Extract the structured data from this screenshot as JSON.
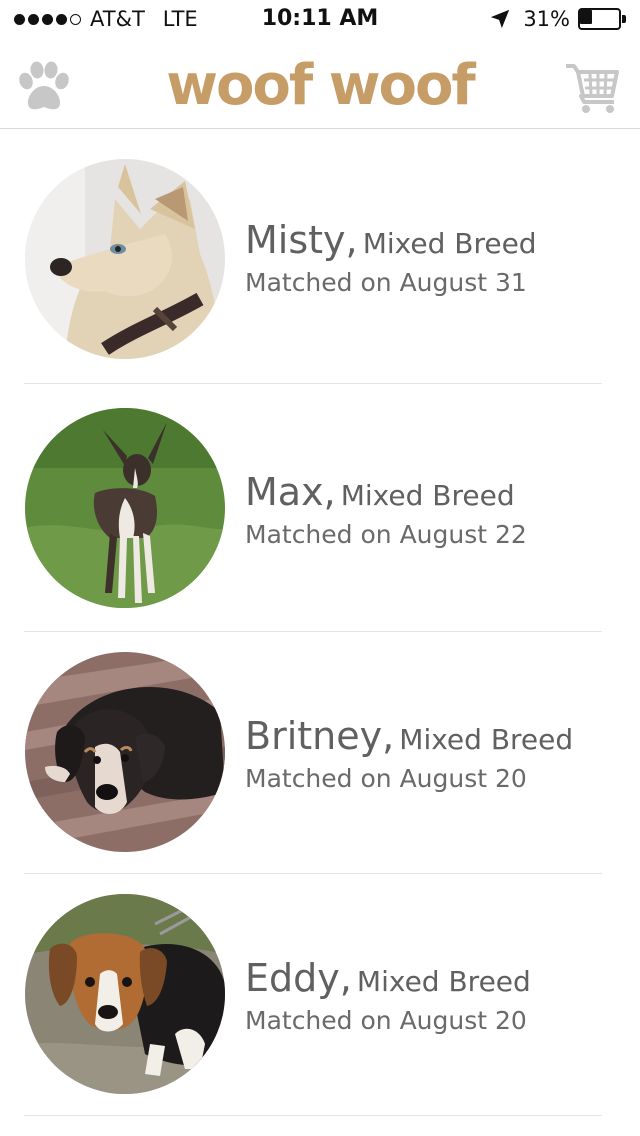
{
  "status_bar": {
    "carrier": "AT&T",
    "network": "LTE",
    "time": "10:11 AM",
    "battery_percent_label": "31%",
    "battery_level": 0.31,
    "signal_bars_filled": 4,
    "signal_bars_total": 5
  },
  "header": {
    "title": "woof woof",
    "left_icon": "paw-icon",
    "right_icon": "shopping-cart-icon",
    "title_color": "#c69d67",
    "icon_color": "#c7c7c7"
  },
  "matches": [
    {
      "name": "Misty,",
      "breed": "Mixed Breed",
      "matched_on": "Matched on August 31",
      "photo": "white-husky-dog"
    },
    {
      "name": "Max,",
      "breed": "Mixed Breed",
      "matched_on": "Matched on August 22",
      "photo": "chihuahua-on-grass"
    },
    {
      "name": "Britney,",
      "breed": "Mixed Breed",
      "matched_on": "Matched on August 20",
      "photo": "black-tan-dog-lying-on-deck"
    },
    {
      "name": "Eddy,",
      "breed": "Mixed Breed",
      "matched_on": "Matched on August 20",
      "photo": "beagle-puppy"
    }
  ]
}
